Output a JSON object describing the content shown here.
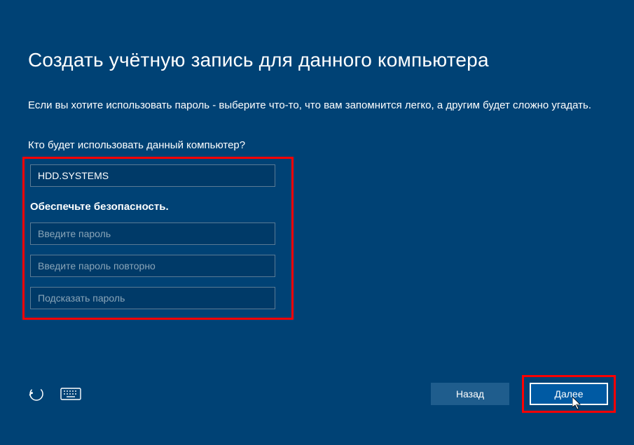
{
  "title": "Создать учётную запись для данного компьютера",
  "description": "Если вы хотите использовать пароль - выберите что-то, что вам запомнится легко, а другим будет сложно угадать.",
  "who_label": "Кто будет использовать данный компьютер?",
  "username_value": "HDD.SYSTEMS",
  "security_label": "Обеспечьте безопасность.",
  "password_placeholder": "Введите пароль",
  "password_confirm_placeholder": "Введите пароль повторно",
  "password_hint_placeholder": "Подсказать пароль",
  "back_button": "Назад",
  "next_button": "Далее"
}
